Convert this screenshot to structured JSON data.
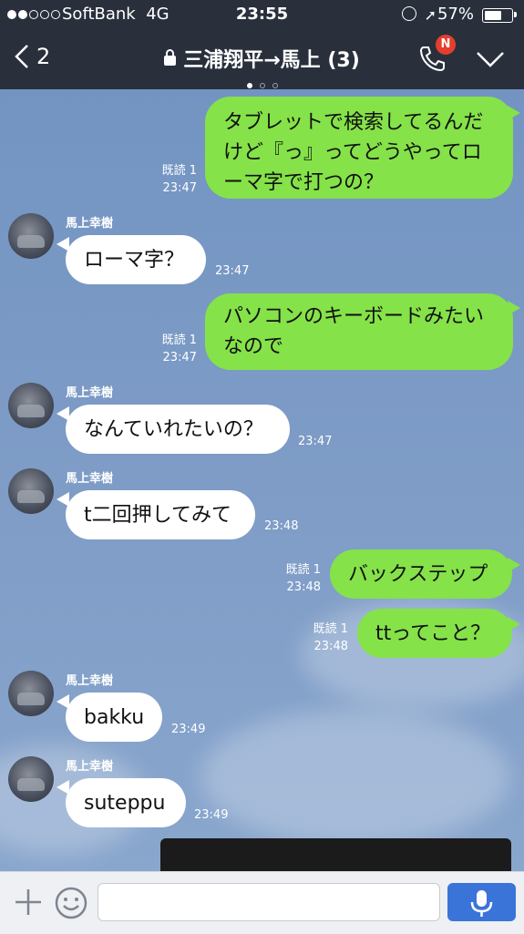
{
  "status_bar": {
    "carrier": "SoftBank",
    "network": "4G",
    "time": "23:55",
    "battery_percent": "57%",
    "signal_bars_filled": 2,
    "signal_bars_total": 5
  },
  "header": {
    "back_count": "2",
    "title": "三浦翔平→馬上 (3)",
    "call_badge": "N",
    "page_indicator": {
      "count": 3,
      "active": 0
    }
  },
  "messages": [
    {
      "id": "m1",
      "direction": "out",
      "text": "タブレットで検索してるんだけど『っ』ってどうやってローマ字で打つの？",
      "lines": [
        "タブレットで検索してるんだ",
        "けど『っ』ってどうやってロ",
        "ーマ字で打つの？"
      ],
      "read": "既読 1",
      "time": "23:47"
    },
    {
      "id": "m2",
      "direction": "in",
      "sender": "馬上幸樹",
      "text": "ローマ字？",
      "time": "23:47"
    },
    {
      "id": "m3",
      "direction": "out",
      "text": "パソコンのキーボードみたいなので",
      "lines": [
        "パソコンのキーボードみたい",
        "なので"
      ],
      "read": "既読 1",
      "time": "23:47"
    },
    {
      "id": "m4",
      "direction": "in",
      "sender": "馬上幸樹",
      "text": "なんていれたいの？",
      "time": "23:47"
    },
    {
      "id": "m5",
      "direction": "in",
      "sender": "馬上幸樹",
      "text": "t二回押してみて",
      "time": "23:48"
    },
    {
      "id": "m6",
      "direction": "out",
      "text": "バックステップ",
      "read": "既読 1",
      "time": "23:48"
    },
    {
      "id": "m7",
      "direction": "out",
      "text": "ttってこと？",
      "read": "既読 1",
      "time": "23:48"
    },
    {
      "id": "m8",
      "direction": "in",
      "sender": "馬上幸樹",
      "text": "bakku",
      "time": "23:49"
    },
    {
      "id": "m9",
      "direction": "in",
      "sender": "馬上幸樹",
      "text": "suteppu",
      "time": "23:49"
    }
  ],
  "input": {
    "value": "",
    "placeholder": ""
  },
  "colors": {
    "outgoing_bubble": "#85e249",
    "incoming_bubble": "#ffffff",
    "header_bg": "#29303c",
    "chat_bg": "#7d9cc7",
    "send_button": "#3b74d9",
    "badge": "#e53e2c"
  }
}
